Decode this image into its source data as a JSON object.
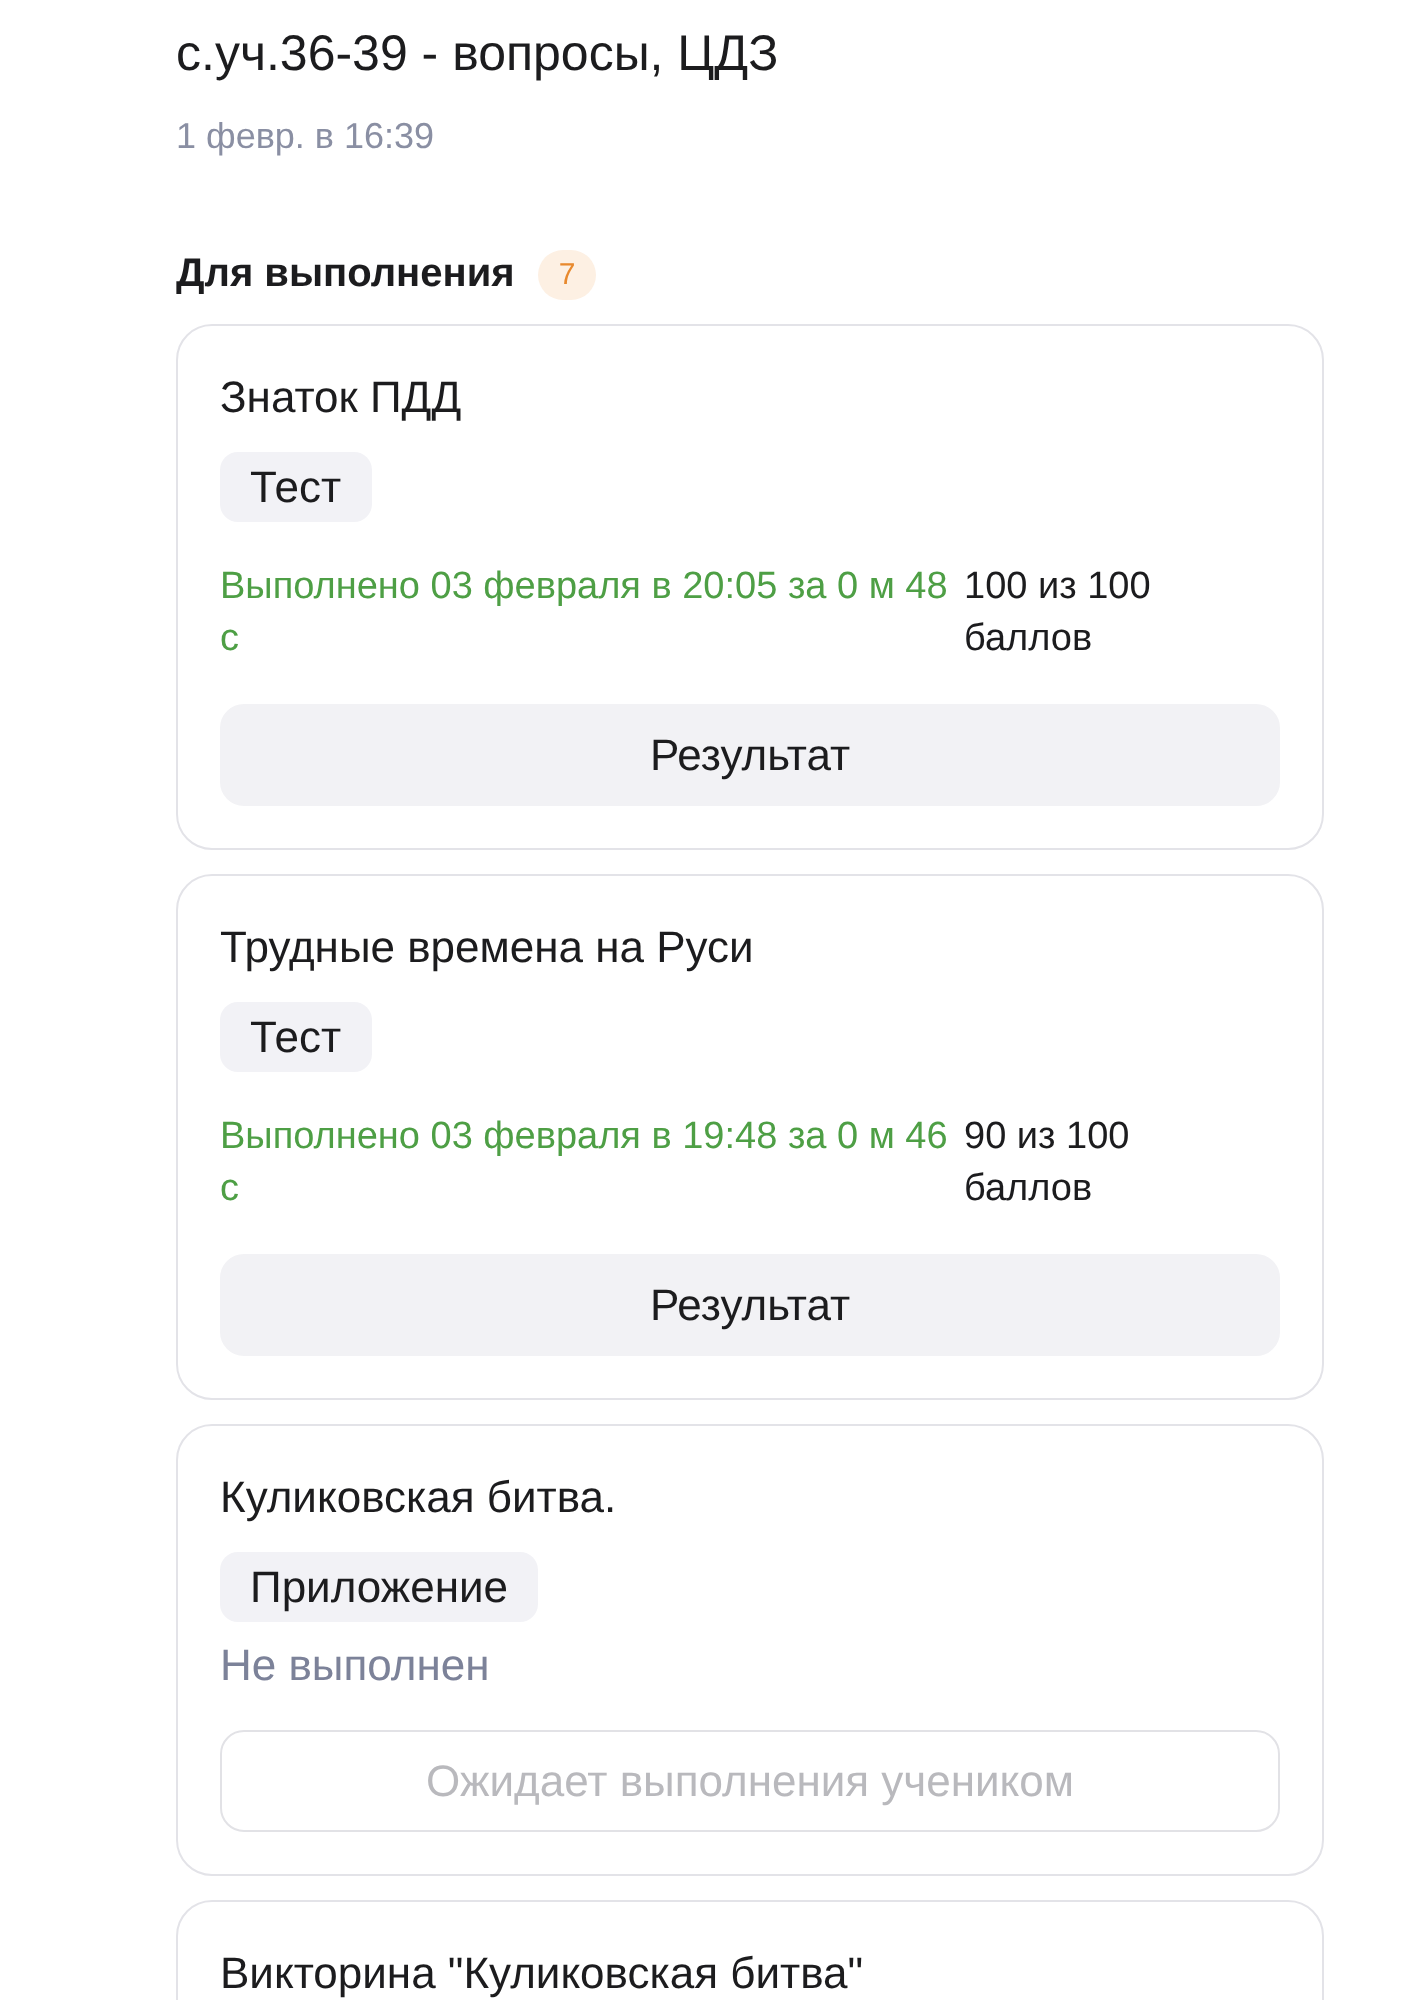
{
  "page": {
    "title": "с.уч.36-39 - вопросы, ЦДЗ",
    "date": "1 февр. в 16:39"
  },
  "section": {
    "title": "Для выполнения",
    "count": "7"
  },
  "tasks": [
    {
      "title": "Знаток ПДД",
      "tag": "Тест",
      "status": {
        "kind": "done",
        "text": "Выполнено 03 февраля в 20:05 за 0 м 48 с"
      },
      "score": "100 из 100 баллов",
      "action": {
        "label": "Результат",
        "disabled": false
      }
    },
    {
      "title": "Трудные времена на Руси",
      "tag": "Тест",
      "status": {
        "kind": "done",
        "text": "Выполнено 03 февраля в 19:48 за 0 м 46 с"
      },
      "score": "90 из 100 баллов",
      "action": {
        "label": "Результат",
        "disabled": false
      }
    },
    {
      "title": "Куликовская битва.",
      "tag": "Приложение",
      "status": {
        "kind": "not_done",
        "text": "Не выполнен"
      },
      "action": {
        "label": "Ожидает выполнения учеником",
        "disabled": true
      }
    },
    {
      "title": "Викторина \"Куликовская битва\""
    }
  ]
}
